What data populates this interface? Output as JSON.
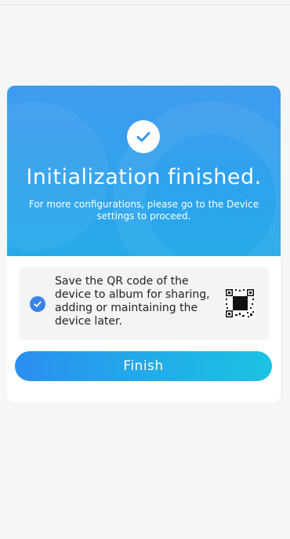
{
  "dialog": {
    "title": "Initialization finished.",
    "subtitle": "For more configurations, please go to the Device settings to proceed.",
    "success_icon": "check-icon",
    "qr_option": {
      "checked": true,
      "text": "Save the QR code of the device to album for sharing, adding or maintaining the device later.",
      "checkbox_icon": "check-icon",
      "image_icon": "qr-code-icon"
    },
    "finish_label": "Finish"
  },
  "colors": {
    "hero_top": "#3f9cf0",
    "hero_bottom": "#26aae9",
    "accent": "#3b82e8",
    "button_start": "#2a8ff0",
    "button_end": "#1dc2e2"
  }
}
